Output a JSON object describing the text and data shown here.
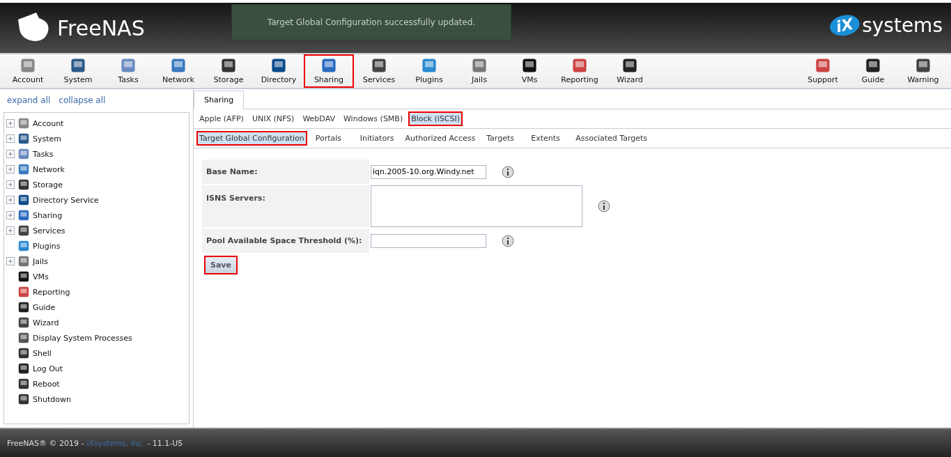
{
  "header": {
    "logo": "FreeNAS",
    "brand": "systems",
    "brand_mark": "iX",
    "notice": "Target Global Configuration successfully updated."
  },
  "nav": [
    {
      "label": "Account",
      "highlighted": false
    },
    {
      "label": "System",
      "highlighted": false
    },
    {
      "label": "Tasks",
      "highlighted": false
    },
    {
      "label": "Network",
      "highlighted": false
    },
    {
      "label": "Storage",
      "highlighted": false
    },
    {
      "label": "Directory",
      "highlighted": false
    },
    {
      "label": "Sharing",
      "highlighted": true
    },
    {
      "label": "Services",
      "highlighted": false
    },
    {
      "label": "Plugins",
      "highlighted": false
    },
    {
      "label": "Jails",
      "highlighted": false
    },
    {
      "label": "VMs",
      "highlighted": false
    },
    {
      "label": "Reporting",
      "highlighted": false
    },
    {
      "label": "Wizard",
      "highlighted": false
    }
  ],
  "nav_right": [
    {
      "label": "Support"
    },
    {
      "label": "Guide"
    },
    {
      "label": "Warning"
    }
  ],
  "sidebar": {
    "links": [
      "expand all",
      "collapse all"
    ],
    "items": [
      {
        "label": "Account",
        "expandable": true
      },
      {
        "label": "System",
        "expandable": true
      },
      {
        "label": "Tasks",
        "expandable": true
      },
      {
        "label": "Network",
        "expandable": true
      },
      {
        "label": "Storage",
        "expandable": true
      },
      {
        "label": "Directory Service",
        "expandable": true
      },
      {
        "label": "Sharing",
        "expandable": true
      },
      {
        "label": "Services",
        "expandable": true
      },
      {
        "label": "Plugins",
        "expandable": false
      },
      {
        "label": "Jails",
        "expandable": true
      },
      {
        "label": "VMs",
        "expandable": false
      },
      {
        "label": "Reporting",
        "expandable": false
      },
      {
        "label": "Guide",
        "expandable": false
      },
      {
        "label": "Wizard",
        "expandable": false
      },
      {
        "label": "Display System Processes",
        "expandable": false
      },
      {
        "label": "Shell",
        "expandable": false
      },
      {
        "label": "Log Out",
        "expandable": false
      },
      {
        "label": "Reboot",
        "expandable": false
      },
      {
        "label": "Shutdown",
        "expandable": false
      }
    ]
  },
  "main_tab": {
    "label": "Sharing",
    "selected": true
  },
  "share_tabs": [
    {
      "label": "Apple (AFP)",
      "selected": false,
      "highlighted": false
    },
    {
      "label": "UNIX (NFS)",
      "selected": false,
      "highlighted": false
    },
    {
      "label": "WebDAV",
      "selected": false,
      "highlighted": false
    },
    {
      "label": "Windows (SMB)",
      "selected": false,
      "highlighted": false
    },
    {
      "label": "Block (iSCSI)",
      "selected": true,
      "highlighted": true
    }
  ],
  "iscsi_tabs": [
    {
      "label": "Target Global Configuration",
      "selected": true,
      "highlighted": true
    },
    {
      "label": "Portals",
      "selected": false,
      "highlighted": false
    },
    {
      "label": "Initiators",
      "selected": false,
      "highlighted": false
    },
    {
      "label": "Authorized Access",
      "selected": false,
      "highlighted": false
    },
    {
      "label": "Targets",
      "selected": false,
      "highlighted": false
    },
    {
      "label": "Extents",
      "selected": false,
      "highlighted": false
    },
    {
      "label": "Associated Targets",
      "selected": false,
      "highlighted": false
    }
  ],
  "form": [
    {
      "label": "Base Name:",
      "kind": "text",
      "value": "iqn.2005-10.org.Windy.net"
    },
    {
      "label": "ISNS Servers:",
      "kind": "textarea"
    },
    {
      "label": "Pool Available Space Threshold (%):",
      "kind": "text"
    }
  ],
  "save_button": {
    "label": "Save",
    "highlighted": true
  },
  "footer": {
    "prefix": "FreeNAS® © 2019 -",
    "link": "iXsystems, Inc.",
    "suffix": "- 11.1-U5"
  }
}
